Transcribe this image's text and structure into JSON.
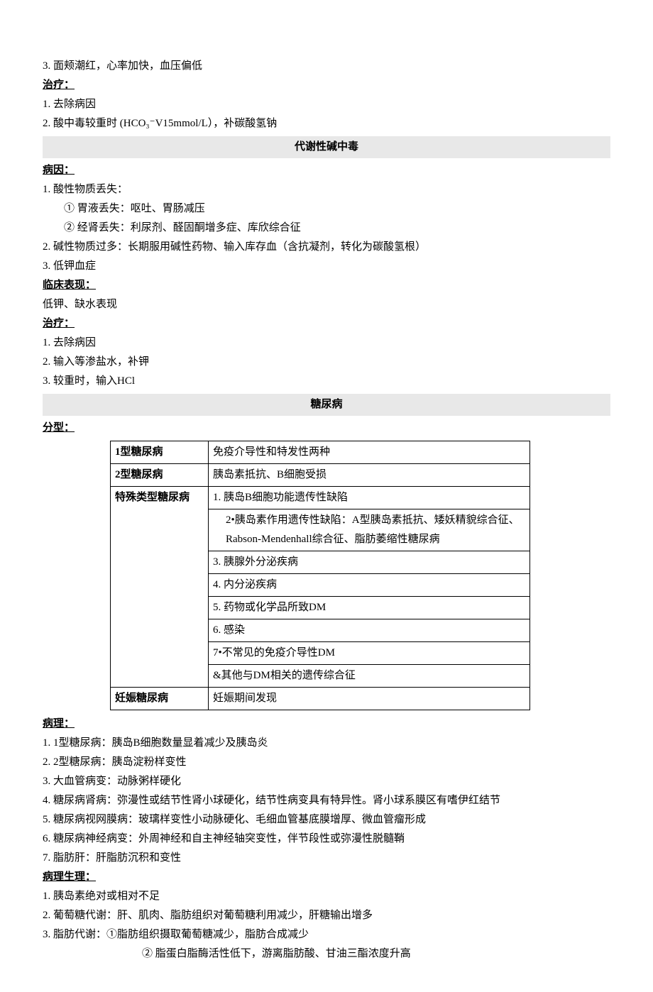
{
  "top": {
    "item3": "3. 面颊潮红，心率加快，血压偏低",
    "treat_h": "治疗：",
    "t1": "1. 去除病因",
    "t2": "2.  酸中毒较重时 (HCO₃⁻V15mmol/L），补碳酸氢钠"
  },
  "alk": {
    "title": "代谢性碱中毒",
    "cause_h": "病因：",
    "c1": "1. 酸性物质丢失：",
    "c1a": "① 胃液丢失：呕吐、胃肠减压",
    "c1b": "② 经肾丢失：利尿剂、醛固酮增多症、库欣综合征",
    "c2": "2. 碱性物质过多：长期服用碱性药物、输入库存血（含抗凝剂，转化为碳酸氢根）",
    "c3": "3. 低钾血症",
    "clin_h": "临床表现：",
    "clin1": "低钾、缺水表现",
    "treat_h": "治疗：",
    "t1": "1. 去除病因",
    "t2": "2. 输入等渗盐水，补钾",
    "t3": "3. 较重时，输入HCl"
  },
  "dm": {
    "title": "糖尿病",
    "type_h": "分型：",
    "table": {
      "r1a": "1型糖尿病",
      "r1b": "免疫介导性和特发性两种",
      "r2a": "2型糖尿病",
      "r2b": "胰岛素抵抗、B细胞受损",
      "r3a": "特殊类型糖尿病",
      "r3b1": "1. 胰岛B细胞功能遗传性缺陷",
      "r3b2": "2•胰岛素作用遗传性缺陷：A型胰岛素抵抗、矮妖精貌综合征、Rabson-Mendenhall综合征、脂肪萎缩性糖尿病",
      "r3b3": "3. 胰腺外分泌疾病",
      "r3b4": "4. 内分泌疾病",
      "r3b5": "5. 药物或化学品所致DM",
      "r3b6": "6. 感染",
      "r3b7": "7•不常见的免疫介导性DM",
      "r3b8": "&其他与DM相关的遗传综合征",
      "r4a": "妊娠糖尿病",
      "r4b": "妊娠期间发现"
    },
    "path_h": "病理：",
    "p1": "1. 1型糖尿病：胰岛B细胞数量显着减少及胰岛炎",
    "p2": "2. 2型糖尿病：胰岛淀粉样变性",
    "p3": "3. 大血管病变：动脉粥样硬化",
    "p4": "4. 糖尿病肾病：弥漫性或结节性肾小球硬化，结节性病变具有特异性。肾小球系膜区有嗜伊红结节",
    "p5": "5. 糖尿病视网膜病：玻璃样变性小动脉硬化、毛细血管基底膜增厚、微血管瘤形成",
    "p6": "6. 糖尿病神经病变：外周神经和自主神经轴突变性，伴节段性或弥漫性脱髓鞘",
    "p7": "7. 脂肪肝：肝脂肪沉积和变性",
    "pp_h": "病理生理：",
    "pp1": "1. 胰岛素绝对或相对不足",
    "pp2": "2. 葡萄糖代谢：肝、肌肉、脂肪组织对葡萄糖利用减少，肝糖输出增多",
    "pp3": "3. 脂肪代谢：①脂肪组织摄取葡萄糖减少，脂肪合成减少",
    "pp3b": "② 脂蛋白脂酶活性低下，游离脂肪酸、甘油三酯浓度升高"
  }
}
